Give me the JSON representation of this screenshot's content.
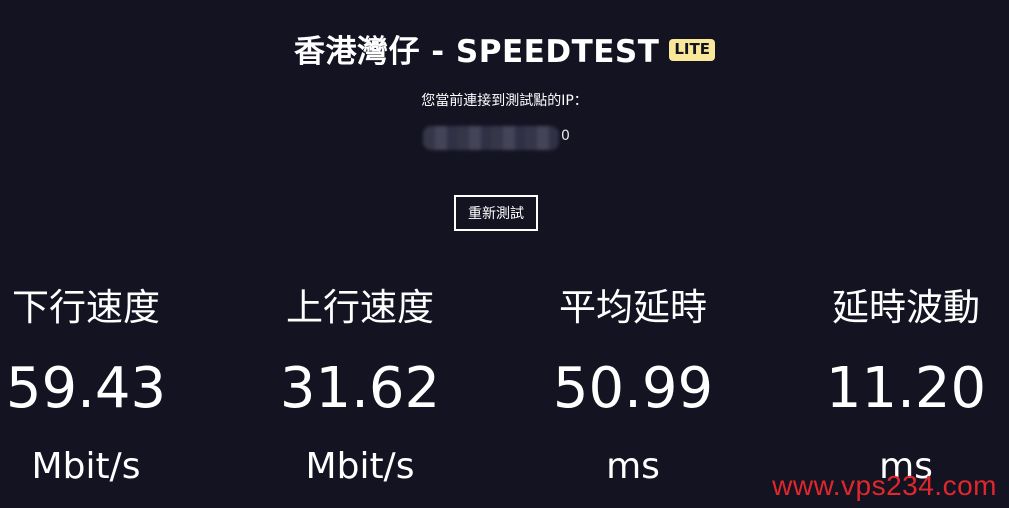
{
  "header": {
    "title": "香港灣仔 - SPEEDTEST",
    "badge": "LITE"
  },
  "ip": {
    "label": "您當前連接到測試點的IP：",
    "visible_suffix": "0"
  },
  "actions": {
    "retest_label": "重新測試"
  },
  "metrics": [
    {
      "label": "下行速度",
      "value": "59.43",
      "unit": "Mbit/s"
    },
    {
      "label": "上行速度",
      "value": "31.62",
      "unit": "Mbit/s"
    },
    {
      "label": "平均延時",
      "value": "50.99",
      "unit": "ms"
    },
    {
      "label": "延時波動",
      "value": "11.20",
      "unit": "ms"
    }
  ],
  "watermark": "www.vps234.com",
  "colors": {
    "background": "#131322",
    "badge": "#f9e79a",
    "watermark": "#e0272b",
    "text": "#ffffff"
  }
}
